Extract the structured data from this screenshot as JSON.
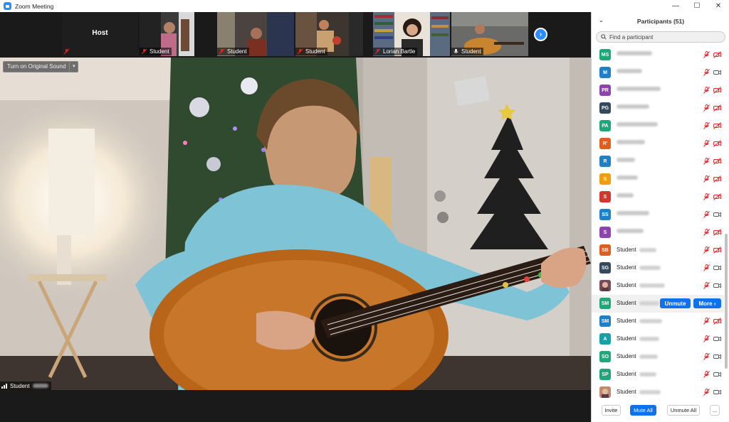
{
  "window": {
    "title": "Zoom Meeting",
    "controls": [
      "minimize",
      "maximize",
      "close"
    ]
  },
  "filmstrip": {
    "tiles": [
      {
        "type": "host",
        "label": "Host",
        "muted": true
      },
      {
        "type": "video",
        "label": "Student",
        "muted": true
      },
      {
        "type": "video",
        "label": "Student",
        "muted": true
      },
      {
        "type": "video",
        "label": "Student",
        "muted": true
      },
      {
        "type": "video",
        "label": "Lorian Bartle",
        "muted": true
      },
      {
        "type": "video",
        "label": "Student",
        "muted": false
      }
    ],
    "next_icon": "chevron-right-icon"
  },
  "main_video": {
    "original_sound_label": "Turn on Original Sound",
    "speaker_label": "Student"
  },
  "participants_panel": {
    "title": "Participants (51)",
    "search_placeholder": "Find a participant",
    "colors": {
      "accent": "#0e72ed",
      "muted_icon": "#e02828"
    },
    "participants": [
      {
        "initials": "MS",
        "color": "#1fa67a",
        "name": "",
        "video_off": true
      },
      {
        "initials": "M",
        "color": "#1e80c8",
        "name": "",
        "video_off": false
      },
      {
        "initials": "PR",
        "color": "#8e44ad",
        "name": "",
        "video_off": true
      },
      {
        "initials": "PG",
        "color": "#34495e",
        "name": "",
        "video_off": true
      },
      {
        "initials": "PA",
        "color": "#1fa67a",
        "name": "",
        "video_off": true
      },
      {
        "initials": "R'",
        "color": "#e05d20",
        "name": "",
        "video_off": true
      },
      {
        "initials": "R",
        "color": "#1e80c8",
        "name": "",
        "video_off": true
      },
      {
        "initials": "S",
        "color": "#f39c12",
        "name": "",
        "video_off": true
      },
      {
        "initials": "S",
        "color": "#d0392b",
        "name": "",
        "video_off": true
      },
      {
        "initials": "SS",
        "color": "#1e80c8",
        "name": "",
        "video_off": false
      },
      {
        "initials": "S",
        "color": "#8e44ad",
        "name": "",
        "video_off": true
      },
      {
        "initials": "SB",
        "color": "#e05d20",
        "name": "Student",
        "video_off": true
      },
      {
        "initials": "SG",
        "color": "#34495e",
        "name": "Student",
        "video_off": false
      },
      {
        "initials": "",
        "color": "#7a4a5a",
        "name": "Student",
        "video_off": false,
        "photo": true
      },
      {
        "initials": "SM",
        "color": "#1fa67a",
        "name": "Student",
        "video_off": false,
        "hover": true
      },
      {
        "initials": "SM",
        "color": "#1e80c8",
        "name": "Student",
        "video_off": true
      },
      {
        "initials": "A",
        "color": "#16a0a8",
        "name": "Student",
        "video_off": false
      },
      {
        "initials": "SO",
        "color": "#1fa67a",
        "name": "Student",
        "video_off": false
      },
      {
        "initials": "SP",
        "color": "#1fa67a",
        "name": "Student",
        "video_off": false
      },
      {
        "initials": "",
        "color": "#c08a70",
        "name": "Student",
        "video_off": false,
        "photo": true
      }
    ],
    "row_actions": {
      "unmute_label": "Unmute",
      "more_label": "More ›"
    },
    "footer": {
      "invite_label": "Invite",
      "mute_all_label": "Mute All",
      "unmute_all_label": "Unmute All",
      "more_label": "..."
    }
  }
}
